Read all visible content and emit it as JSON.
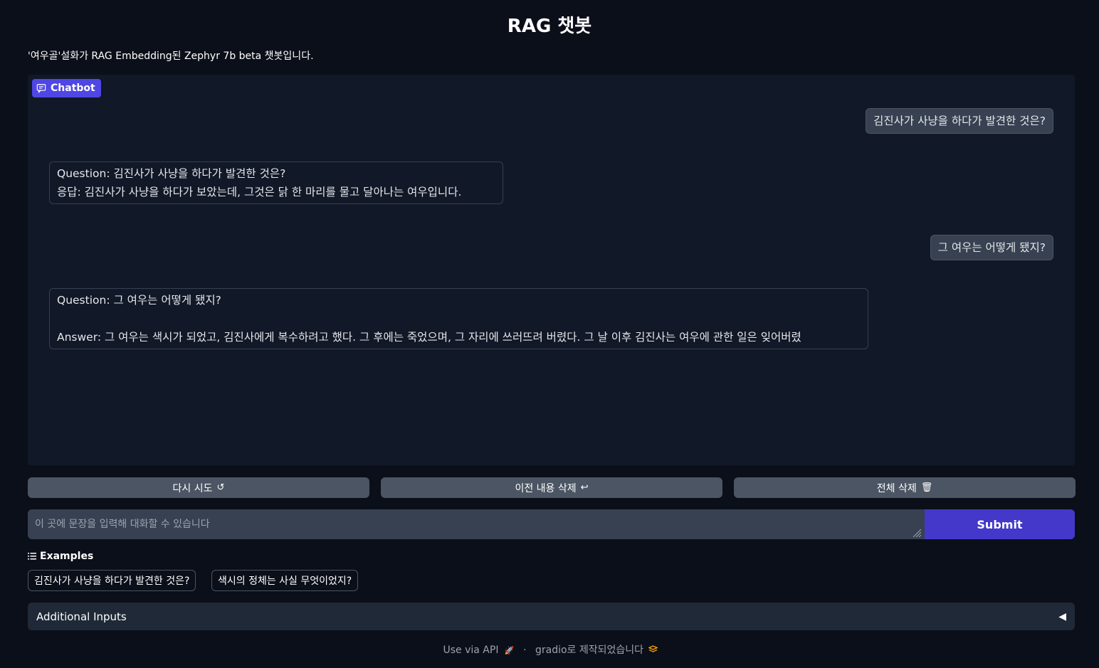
{
  "header": {
    "title": "RAG 챗봇",
    "description": "'여우골'설화가 RAG Embedding된 Zephyr 7b beta 챗봇입니다."
  },
  "chatbot": {
    "label": "Chatbot",
    "messages": [
      {
        "role": "user",
        "text": "김진사가 사냥을 하다가 발견한 것은?"
      },
      {
        "role": "bot",
        "text": "Question: 김진사가 사냥을 하다가 발견한 것은?\n응답: 김진사가 사냥을 하다가 보았는데, 그것은 닭 한 마리를 물고 달아나는 여우입니다."
      },
      {
        "role": "user",
        "text": "그 여우는 어떻게 됐지?"
      },
      {
        "role": "bot",
        "text": "Question: 그 여우는 어떻게 됐지?\n\nAnswer: 그 여우는 색시가 되었고, 김진사에게 복수하려고 했다. 그 후에는 죽었으며, 그 자리에 쓰러뜨려 버렸다. 그 날 이후 김진사는 여우에 관한 일은 잊어버렸"
      }
    ]
  },
  "controls": {
    "retry_label": "다시 시도",
    "retry_icon": "↺",
    "undo_label": "이전 내용 삭제",
    "undo_icon": "↩",
    "clear_label": "전체 삭제",
    "clear_icon": "🗑"
  },
  "input": {
    "placeholder": "이 곳에 문장을 입력해 대화할 수 있습니다",
    "value": "",
    "submit_label": "Submit"
  },
  "examples": {
    "heading": "Examples",
    "items": [
      "김진사가 사냥을 하다가 발견한 것은?",
      "색시의 정체는 사실 무엇이었지?"
    ]
  },
  "additional_inputs": {
    "label": "Additional Inputs",
    "toggle_icon": "◀"
  },
  "footer": {
    "api_label": "Use via API",
    "api_icon": "🚀",
    "separator": "·",
    "built_with": "gradio로 제작되었습니다",
    "gradio_icon": "gradio-logo-icon"
  },
  "colors": {
    "background": "#0b0f19",
    "panel": "#111827",
    "accent": "#4f46e5",
    "submit": "#4338ca",
    "button": "#4b5563",
    "user_bubble": "#374151"
  }
}
